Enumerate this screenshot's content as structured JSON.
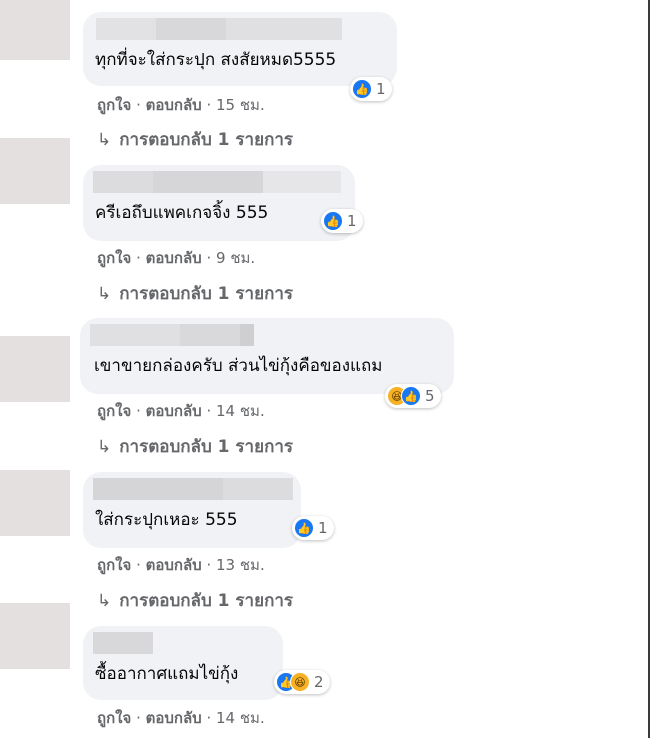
{
  "comments": [
    {
      "text": "ทุกที่จะใส่กระปุก สงสัยหมด5555",
      "like_label": "ถูกใจ",
      "reply_label": "ตอบกลับ",
      "time": "15 ชม.",
      "reactions": [
        "like"
      ],
      "reaction_count": "1",
      "replies": "การตอบกลับ 1 รายการ"
    },
    {
      "text": "ครีเอถึบแพคเกจจิ้ง 555",
      "like_label": "ถูกใจ",
      "reply_label": "ตอบกลับ",
      "time": "9 ชม.",
      "reactions": [
        "like"
      ],
      "reaction_count": "1",
      "replies": "การตอบกลับ 1 รายการ"
    },
    {
      "text": "เขาขายกล่องครับ ส่วนไข่กุ้งคือของแถม",
      "like_label": "ถูกใจ",
      "reply_label": "ตอบกลับ",
      "time": "14 ชม.",
      "reactions": [
        "haha",
        "like"
      ],
      "reaction_count": "5",
      "replies": "การตอบกลับ 1 รายการ"
    },
    {
      "text": "ใส่กระปุกเหอะ 555",
      "like_label": "ถูกใจ",
      "reply_label": "ตอบกลับ",
      "time": "13 ชม.",
      "reactions": [
        "like"
      ],
      "reaction_count": "1",
      "replies": "การตอบกลับ 1 รายการ"
    },
    {
      "text": "ซื้ออากาศแถมไข่กุ้ง",
      "like_label": "ถูกใจ",
      "reply_label": "ตอบกลับ",
      "time": "14 ชม.",
      "reactions": [
        "like",
        "haha"
      ],
      "reaction_count": "2"
    }
  ],
  "colors": {
    "bubble": "#f0f2f5",
    "meta_text": "#65676b",
    "like_blue": "#1877f2",
    "haha_yellow": "#f7b125"
  },
  "icons": {
    "like": "like-icon",
    "haha": "haha-icon",
    "reply_arrow": "reply-arrow-icon"
  }
}
